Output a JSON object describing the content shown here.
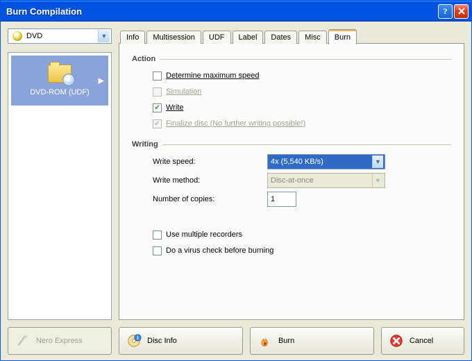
{
  "window": {
    "title": "Burn Compilation"
  },
  "disc_selector": {
    "label": "DVD"
  },
  "type_panel": {
    "selected_label": "DVD-ROM (UDF)"
  },
  "tabs": [
    {
      "label": "Info"
    },
    {
      "label": "Multisession"
    },
    {
      "label": "UDF"
    },
    {
      "label": "Label"
    },
    {
      "label": "Dates"
    },
    {
      "label": "Misc"
    },
    {
      "label": "Burn"
    }
  ],
  "burn_tab": {
    "section_action": "Action",
    "action": {
      "determine_max_speed": {
        "label": "Determine maximum speed",
        "checked": false,
        "enabled": true
      },
      "simulation": {
        "label": "Simulation",
        "checked": false,
        "enabled": false
      },
      "write": {
        "label": "Write",
        "checked": true,
        "enabled": true
      },
      "finalize": {
        "label": "Finalize disc (No further writing possible!)",
        "checked": true,
        "enabled": false
      }
    },
    "section_writing": "Writing",
    "writing": {
      "write_speed": {
        "label": "Write speed:",
        "value": "4x (5,540 KB/s)"
      },
      "write_method": {
        "label": "Write method:",
        "value": "Disc-at-once"
      },
      "number_copies": {
        "label": "Number of copies:",
        "value": "1"
      }
    },
    "extras": {
      "multi_recorders": {
        "label": "Use multiple recorders",
        "checked": false
      },
      "virus_check": {
        "label": "Do a virus check before burning",
        "checked": false
      }
    }
  },
  "buttons": {
    "nero_express": "Nero Express",
    "disc_info": "Disc Info",
    "burn": "Burn",
    "cancel": "Cancel"
  }
}
